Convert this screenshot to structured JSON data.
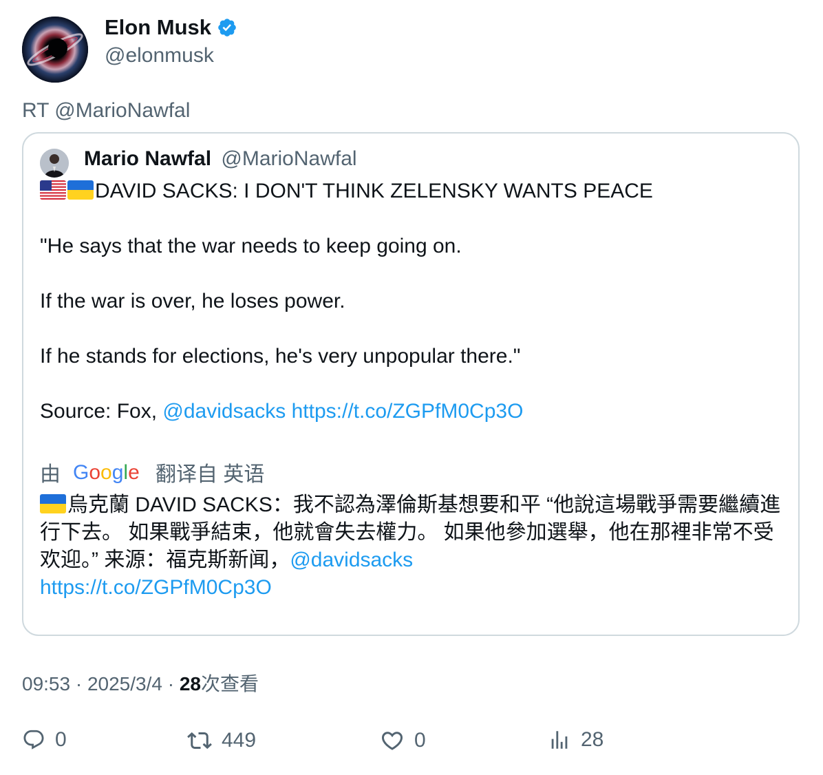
{
  "author": {
    "display_name": "Elon Musk",
    "handle": "@elonmusk",
    "verified_icon": "verified-badge-icon"
  },
  "retweet_line": "RT @MarioNawfal",
  "quoted": {
    "display_name": "Mario Nawfal",
    "handle": "@MarioNawfal",
    "headline": "DAVID SACKS: I DON'T THINK ZELENSKY WANTS PEACE",
    "headline_flags": [
      "us-flag-icon",
      "ukraine-flag-icon"
    ],
    "paragraph_1": "\"He says that the war needs to keep going on.",
    "paragraph_2": "If the war is over, he loses power.",
    "paragraph_3": "If he stands for elections, he's very unpopular there.\"",
    "source_prefix": "Source: Fox,",
    "source_mention": "@davidsacks",
    "source_link": "https://t.co/ZGPfM0Cp3O",
    "translate_by": "由",
    "translate_from": "翻译自 英语",
    "translation_text": "烏克蘭 DAVID SACKS：我不認為澤倫斯基想要和平 “他說這場戰爭需要繼續進行下去。 如果戰爭結束，他就會失去權力。 如果他參加選舉，他在那裡非常不受欢迎。” 来源：福克斯新闻，",
    "translation_mention": "@davidsacks",
    "translation_link": "https://t.co/ZGPfM0Cp3O"
  },
  "meta": {
    "time": "09:53",
    "date": "2025/3/4",
    "views_count": "28",
    "views_label": "次查看"
  },
  "actions": {
    "replies": "0",
    "retweets": "449",
    "likes": "0",
    "views": "28"
  },
  "colors": {
    "link": "#1d9bf0",
    "secondary_text": "#536471",
    "primary_text": "#0f1419",
    "border": "#cfd9de"
  }
}
